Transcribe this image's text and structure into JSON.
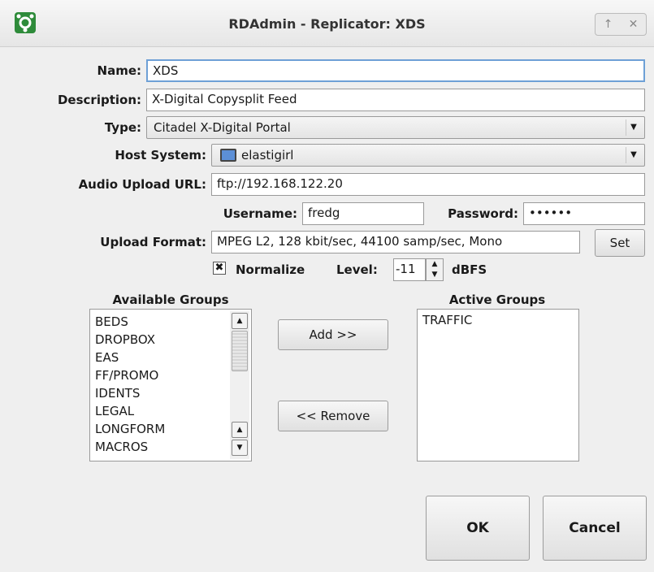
{
  "window": {
    "title": "RDAdmin - Replicator: XDS",
    "app_icon": "gear-icon",
    "buttons": [
      "↑",
      "✕"
    ]
  },
  "form": {
    "name_label": "Name:",
    "name_value": "XDS",
    "description_label": "Description:",
    "description_value": "X-Digital Copysplit Feed",
    "type_label": "Type:",
    "type_value": "Citadel X-Digital Portal",
    "host_label": "Host System:",
    "host_value": "elastigirl",
    "url_label": "Audio Upload URL:",
    "url_value": "ftp://192.168.122.20",
    "username_label": "Username:",
    "username_value": "fredg",
    "password_label": "Password:",
    "password_value": "••••••",
    "format_label": "Upload Format:",
    "format_value": "MPEG L2, 128 kbit/sec, 44100 samp/sec, Mono",
    "set_label": "Set",
    "normalize_label": "Normalize",
    "normalize_checked": true,
    "level_label": "Level:",
    "level_value": "-11",
    "level_unit": "dBFS"
  },
  "groups": {
    "available_label": "Available Groups",
    "available": [
      "BEDS",
      "DROPBOX",
      "EAS",
      "FF/PROMO",
      "IDENTS",
      "LEGAL",
      "LONGFORM",
      "MACROS"
    ],
    "active_label": "Active Groups",
    "active": [
      "TRAFFIC"
    ],
    "add_label": "Add >>",
    "remove_label": "<< Remove"
  },
  "actions": {
    "ok_label": "OK",
    "cancel_label": "Cancel"
  }
}
